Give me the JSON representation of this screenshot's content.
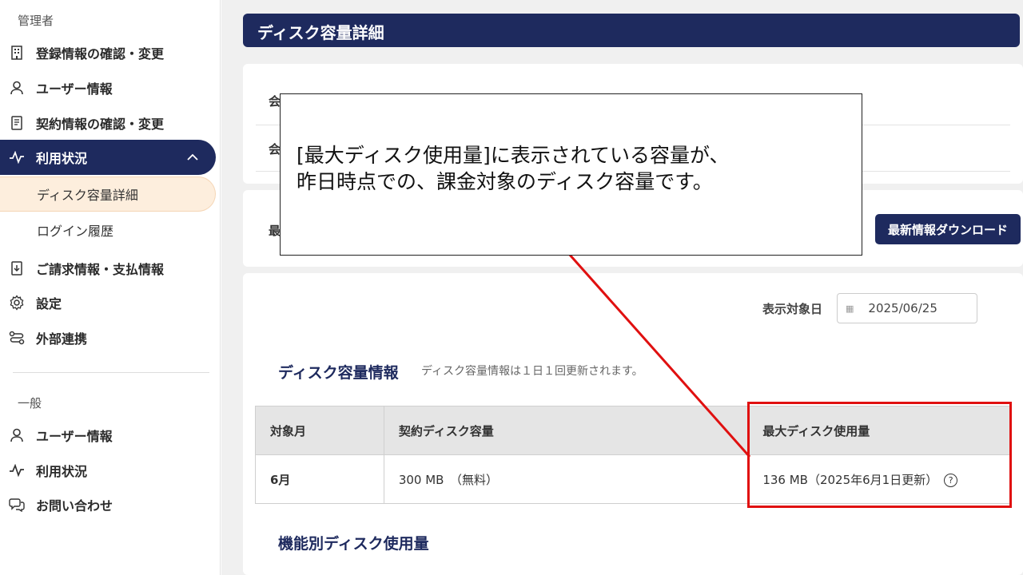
{
  "sidebar": {
    "admin_title": "管理者",
    "admin_items": [
      {
        "label": "登録情報の確認・変更",
        "icon": "building-icon"
      },
      {
        "label": "ユーザー情報",
        "icon": "user-icon"
      },
      {
        "label": "契約情報の確認・変更",
        "icon": "document-icon"
      },
      {
        "label": "利用状況",
        "icon": "activity-icon"
      }
    ],
    "usage_subitems": [
      "ディスク容量詳細",
      "ログイン履歴"
    ],
    "more_items": [
      {
        "label": "ご請求情報・支払情報",
        "icon": "invoice-icon"
      },
      {
        "label": "設定",
        "icon": "gear-icon"
      },
      {
        "label": "外部連携",
        "icon": "link-icon"
      }
    ],
    "general_title": "一般",
    "general_items": [
      {
        "label": "ユーザー情報",
        "icon": "user-icon"
      },
      {
        "label": "利用状況",
        "icon": "activity-icon"
      },
      {
        "label": "お問い合わせ",
        "icon": "chat-icon"
      }
    ]
  },
  "main": {
    "page_title": "ディスク容量詳細",
    "info_rows": [
      "会",
      "会"
    ],
    "latest_label": "最",
    "download_button": "最新情報ダウンロード",
    "date_label": "表示対象日",
    "date_value": "2025/06/25",
    "disk_info_heading": "ディスク容量情報",
    "disk_info_note": "ディスク容量情報は１日１回更新されます。",
    "table": {
      "headers": [
        "対象月",
        "契約ディスク容量",
        "最大ディスク使用量"
      ],
      "rows": [
        [
          "6月",
          "300 MB　（無料）",
          "136 MB（2025年6月1日更新）"
        ]
      ]
    },
    "feature_heading": "機能別ディスク使用量"
  },
  "callout": {
    "line1": "[最大ディスク使用量]に表示されている容量が、",
    "line2": "昨日時点での、課金対象のディスク容量です。"
  },
  "colors": {
    "navy": "#1e2a5e",
    "highlight": "#e01010",
    "subitem_bg": "#fdeedd"
  }
}
